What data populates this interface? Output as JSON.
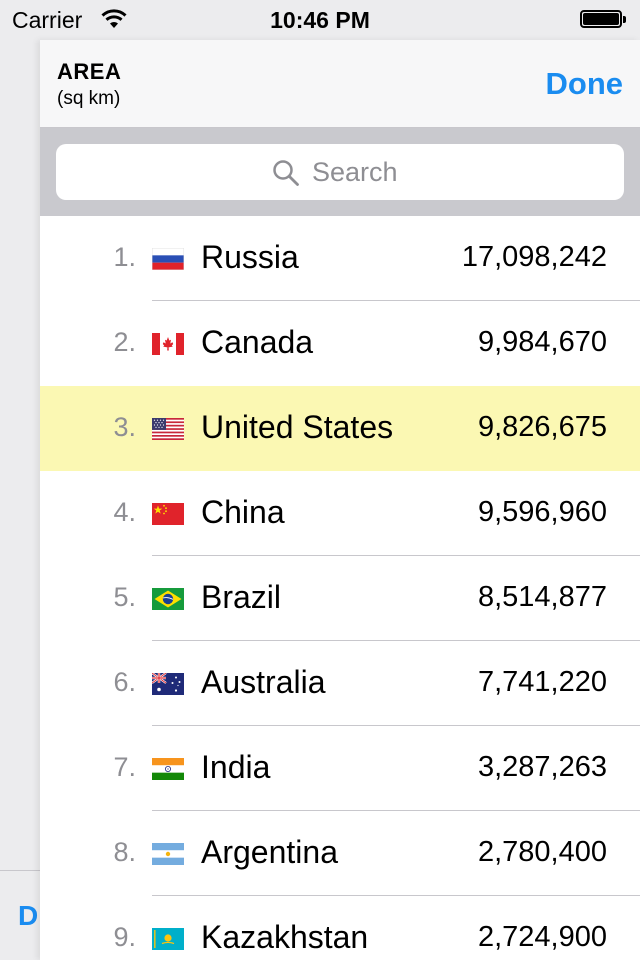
{
  "status_bar": {
    "carrier": "Carrier",
    "time": "10:46 PM"
  },
  "behind": {
    "partial_label": "D"
  },
  "nav": {
    "title": "AREA",
    "subtitle": "(sq km)",
    "done_label": "Done"
  },
  "search": {
    "placeholder": "Search",
    "value": ""
  },
  "highlight_color": "#fbf8b3",
  "accent_color": "#1a8cf0",
  "countries": [
    {
      "rank": "1.",
      "name": "Russia",
      "value": "17,098,242",
      "flag": "russia-flag"
    },
    {
      "rank": "2.",
      "name": "Canada",
      "value": "9,984,670",
      "flag": "canada-flag"
    },
    {
      "rank": "3.",
      "name": "United States",
      "value": "9,826,675",
      "flag": "usa-flag",
      "highlighted": true
    },
    {
      "rank": "4.",
      "name": "China",
      "value": "9,596,960",
      "flag": "china-flag"
    },
    {
      "rank": "5.",
      "name": "Brazil",
      "value": "8,514,877",
      "flag": "brazil-flag"
    },
    {
      "rank": "6.",
      "name": "Australia",
      "value": "7,741,220",
      "flag": "australia-flag"
    },
    {
      "rank": "7.",
      "name": "India",
      "value": "3,287,263",
      "flag": "india-flag"
    },
    {
      "rank": "8.",
      "name": "Argentina",
      "value": "2,780,400",
      "flag": "argentina-flag"
    },
    {
      "rank": "9.",
      "name": "Kazakhstan",
      "value": "2,724,900",
      "flag": "kazakhstan-flag"
    }
  ]
}
